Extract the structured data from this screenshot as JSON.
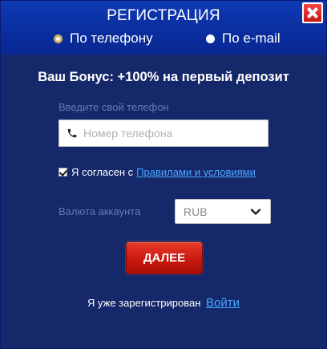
{
  "header": {
    "title": "РЕГИСТРАЦИЯ"
  },
  "tabs": {
    "phone_label": "По телефону",
    "email_label": "По e-mail",
    "selected": "phone"
  },
  "bonus": {
    "text": "Ваш Бонус: +100% на первый депозит"
  },
  "phone": {
    "label": "Введите свой телефон",
    "placeholder": "Номер телефона",
    "value": ""
  },
  "agreement": {
    "checked": true,
    "text": "Я согласен с",
    "link_text": "Правилами и условиями"
  },
  "currency": {
    "label": "Валюта аккаунта",
    "selected": "RUB"
  },
  "submit": {
    "label": "ДАЛЕЕ"
  },
  "footer": {
    "text": "Я уже зарегистрирован",
    "login_link": "Войти"
  },
  "colors": {
    "header_bg": "#0a2ea0",
    "body_bg": "#15286a",
    "button_red": "#c9190f",
    "link_blue": "#4aa8ff",
    "muted_label": "#6679b8"
  },
  "icons": {
    "close": "close-icon",
    "phone": "phone-icon",
    "chevron": "chevron-down-icon",
    "checkbox": "checkmark-icon"
  }
}
